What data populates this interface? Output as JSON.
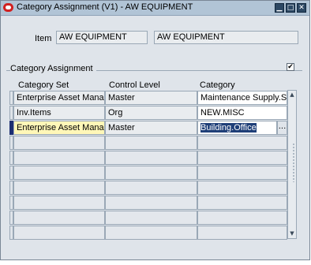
{
  "window": {
    "title": "Category Assignment (V1) - AW EQUIPMENT",
    "buttons": {
      "minimize_glyph": "▁",
      "maximize_glyph": "□",
      "close_glyph": "✕"
    }
  },
  "item": {
    "label": "Item",
    "value": "AW EQUIPMENT",
    "description": "AW EQUIPMENT"
  },
  "section": {
    "title": "Category Assignment",
    "checkbox_checked": true,
    "checkbox_glyph": "✔"
  },
  "table": {
    "headers": [
      "Category Set",
      "Control Level",
      "Category"
    ],
    "rows": [
      {
        "category_set": "Enterprise Asset Manag",
        "control_level": "Master",
        "category": "Maintenance Supply.Su"
      },
      {
        "category_set": "Inv.Items",
        "control_level": "Org",
        "category": "NEW.MISC"
      },
      {
        "category_set": "Enterprise Asset Manag",
        "control_level": "Master",
        "category": "Building.Office"
      }
    ],
    "lov_glyph": "...",
    "scroll_up_glyph": "▲",
    "scroll_down_glyph": "▼"
  }
}
